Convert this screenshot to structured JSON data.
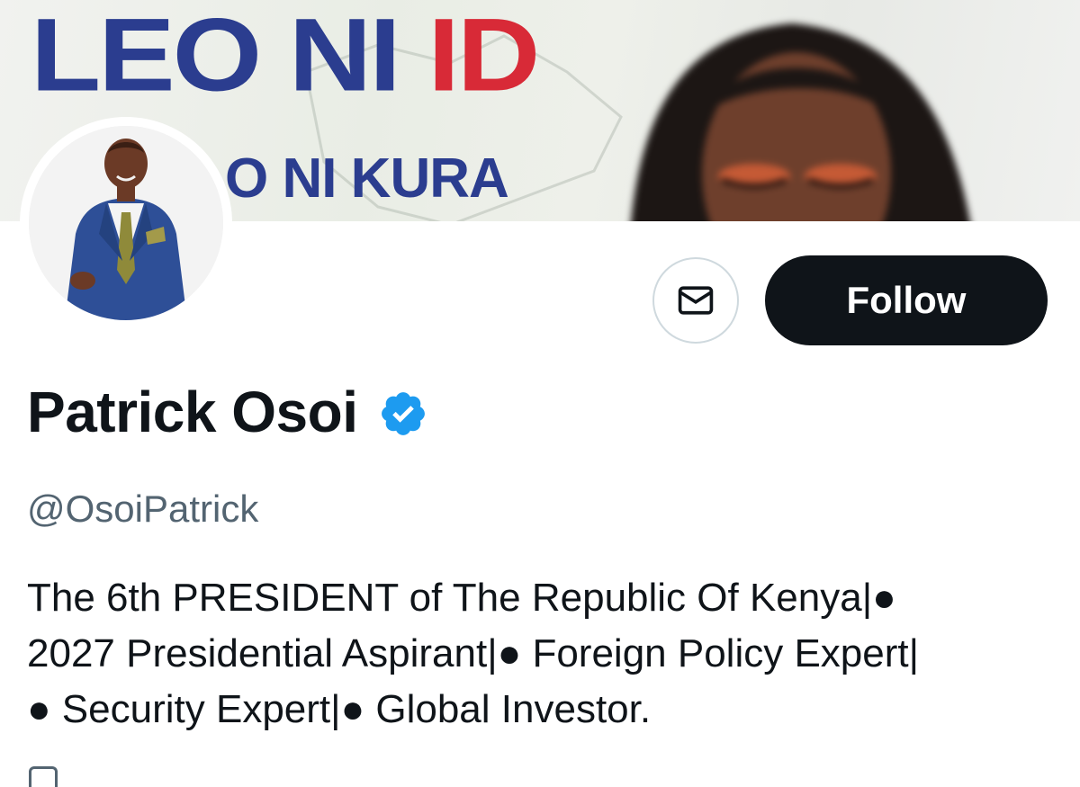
{
  "banner": {
    "title_part1": "LEO NI ",
    "title_part2": "ID",
    "subtitle": "O NI KURA"
  },
  "profile": {
    "display_name": "Patrick Osoi",
    "handle": "@OsoiPatrick",
    "verified": true,
    "bio_lines": [
      "The 6th PRESIDENT of The Republic Of Kenya|●",
      "2027 Presidential Aspirant|● Foreign Policy Expert|",
      "● Security Expert|● Global Investor."
    ]
  },
  "actions": {
    "follow_label": "Follow",
    "message_icon": "envelope-icon"
  },
  "colors": {
    "brand_blue": "#2b3d8f",
    "brand_red": "#d82a37",
    "verified_blue": "#1d9bf0",
    "follow_bg": "#0f1419",
    "muted_text": "#536471"
  }
}
